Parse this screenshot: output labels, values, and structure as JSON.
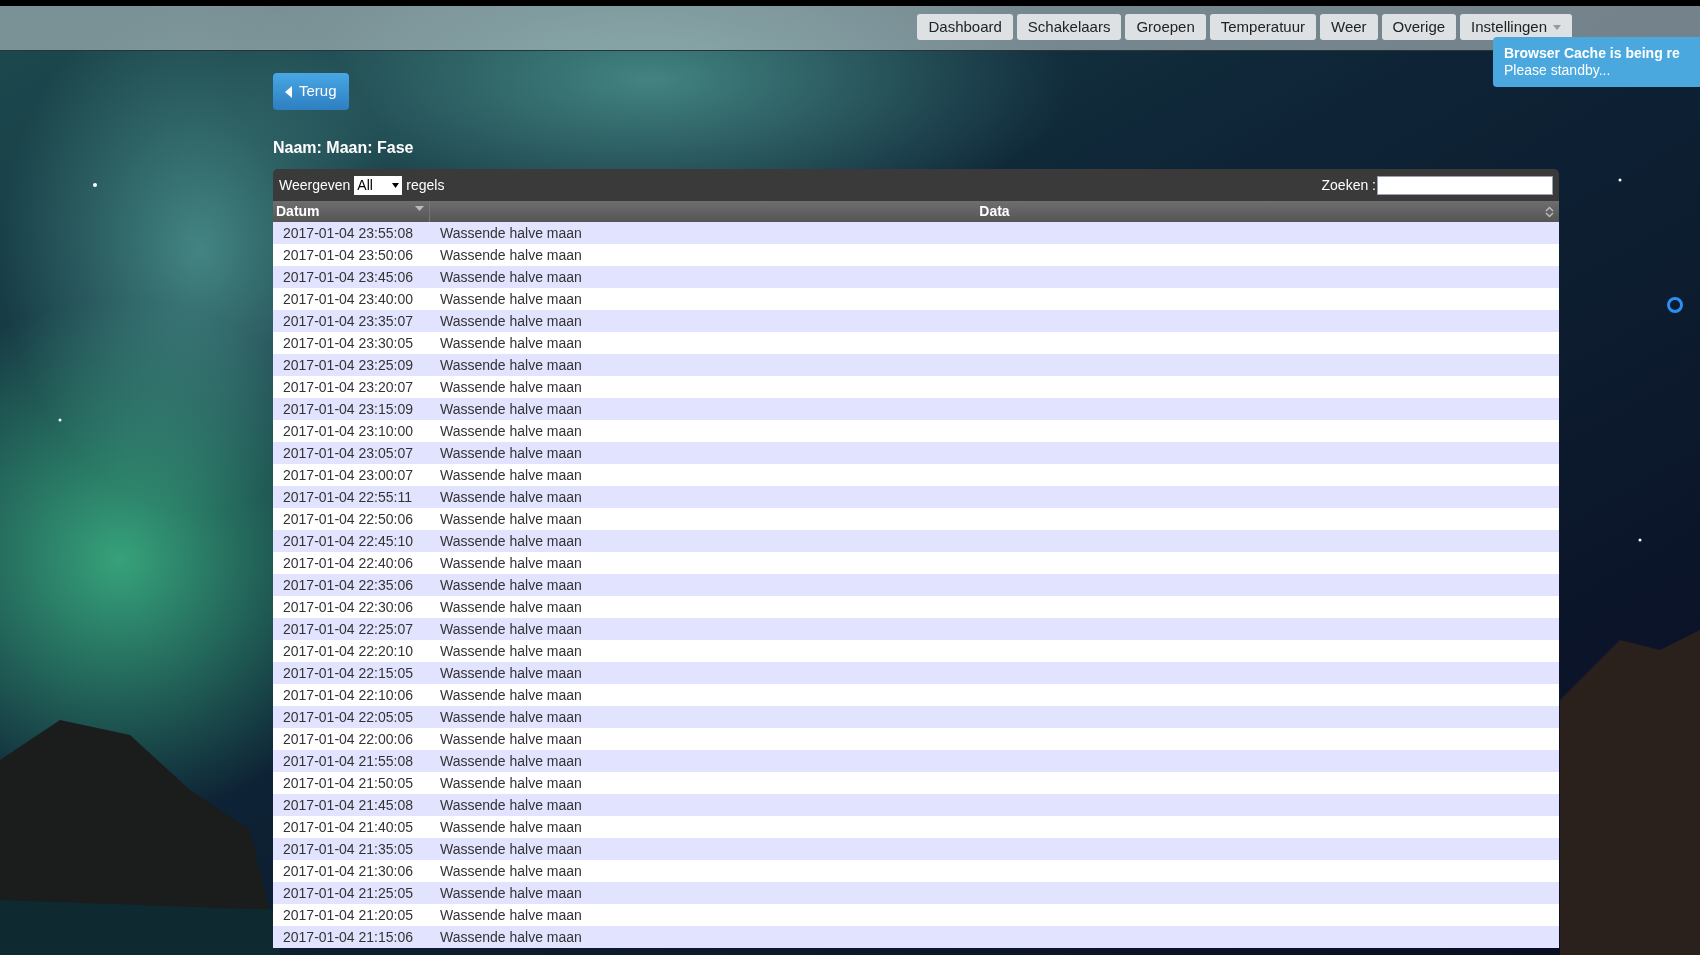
{
  "nav": {
    "items": [
      {
        "label": "Dashboard"
      },
      {
        "label": "Schakelaars"
      },
      {
        "label": "Groepen"
      },
      {
        "label": "Temperatuur"
      },
      {
        "label": "Weer"
      },
      {
        "label": "Overige"
      },
      {
        "label": "Instellingen",
        "dropdown": true
      }
    ]
  },
  "notification": {
    "title": "Browser Cache is being re",
    "message": "Please standby..."
  },
  "back_button": {
    "label": "Terug"
  },
  "heading": "Naam: Maan: Fase",
  "table": {
    "length_label_before": "Weergeven",
    "length_value": "All",
    "length_label_after": "regels",
    "search_label": "Zoeken :",
    "columns": [
      {
        "label": "Datum",
        "kind": "descending"
      },
      {
        "label": "Data",
        "kind": "sortable"
      }
    ],
    "rows": [
      [
        "2017-01-04 23:55:08",
        "Wassende halve maan"
      ],
      [
        "2017-01-04 23:50:06",
        "Wassende halve maan"
      ],
      [
        "2017-01-04 23:45:06",
        "Wassende halve maan"
      ],
      [
        "2017-01-04 23:40:00",
        "Wassende halve maan"
      ],
      [
        "2017-01-04 23:35:07",
        "Wassende halve maan"
      ],
      [
        "2017-01-04 23:30:05",
        "Wassende halve maan"
      ],
      [
        "2017-01-04 23:25:09",
        "Wassende halve maan"
      ],
      [
        "2017-01-04 23:20:07",
        "Wassende halve maan"
      ],
      [
        "2017-01-04 23:15:09",
        "Wassende halve maan"
      ],
      [
        "2017-01-04 23:10:00",
        "Wassende halve maan"
      ],
      [
        "2017-01-04 23:05:07",
        "Wassende halve maan"
      ],
      [
        "2017-01-04 23:00:07",
        "Wassende halve maan"
      ],
      [
        "2017-01-04 22:55:11",
        "Wassende halve maan"
      ],
      [
        "2017-01-04 22:50:06",
        "Wassende halve maan"
      ],
      [
        "2017-01-04 22:45:10",
        "Wassende halve maan"
      ],
      [
        "2017-01-04 22:40:06",
        "Wassende halve maan"
      ],
      [
        "2017-01-04 22:35:06",
        "Wassende halve maan"
      ],
      [
        "2017-01-04 22:30:06",
        "Wassende halve maan"
      ],
      [
        "2017-01-04 22:25:07",
        "Wassende halve maan"
      ],
      [
        "2017-01-04 22:20:10",
        "Wassende halve maan"
      ],
      [
        "2017-01-04 22:15:05",
        "Wassende halve maan"
      ],
      [
        "2017-01-04 22:10:06",
        "Wassende halve maan"
      ],
      [
        "2017-01-04 22:05:05",
        "Wassende halve maan"
      ],
      [
        "2017-01-04 22:00:06",
        "Wassende halve maan"
      ],
      [
        "2017-01-04 21:55:08",
        "Wassende halve maan"
      ],
      [
        "2017-01-04 21:50:05",
        "Wassende halve maan"
      ],
      [
        "2017-01-04 21:45:08",
        "Wassende halve maan"
      ],
      [
        "2017-01-04 21:40:05",
        "Wassende halve maan"
      ],
      [
        "2017-01-04 21:35:05",
        "Wassende halve maan"
      ],
      [
        "2017-01-04 21:30:06",
        "Wassende halve maan"
      ],
      [
        "2017-01-04 21:25:05",
        "Wassende halve maan"
      ],
      [
        "2017-01-04 21:20:05",
        "Wassende halve maan"
      ],
      [
        "2017-01-04 21:15:06",
        "Wassende halve maan"
      ]
    ]
  }
}
